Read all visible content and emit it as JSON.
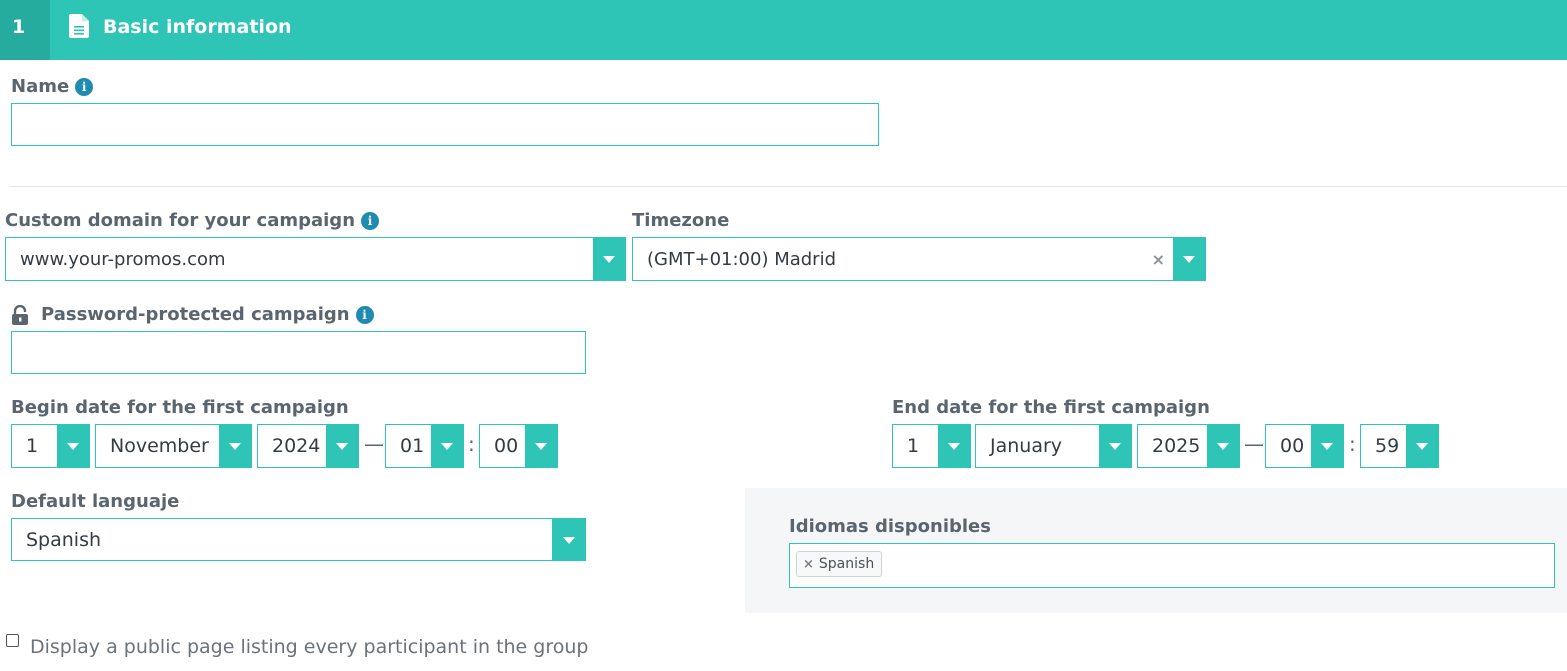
{
  "header": {
    "step_number": "1",
    "title": "Basic information",
    "icon": "file-text-icon",
    "color": "#2ec4b6"
  },
  "name_field": {
    "label": "Name",
    "value": "",
    "placeholder": ""
  },
  "domain": {
    "label": "Custom domain for your campaign",
    "value": "www.your-promos.com"
  },
  "timezone": {
    "label": "Timezone",
    "value": "(GMT+01:00) Madrid",
    "clear": "×"
  },
  "password": {
    "label": "Password-protected campaign",
    "value": ""
  },
  "begin_date": {
    "label": "Begin date for the first campaign",
    "day": "1",
    "month": "November",
    "year": "2024",
    "hour": "01",
    "minute": "00"
  },
  "end_date": {
    "label": "End date for the first campaign",
    "day": "1",
    "month": "January",
    "year": "2025",
    "hour": "00",
    "minute": "59"
  },
  "separators": {
    "dash": "—",
    "colon": ":"
  },
  "default_language": {
    "label": "Default languaje",
    "value": "Spanish"
  },
  "available_languages": {
    "label": "Idiomas disponibles",
    "tags": [
      {
        "label": "Spanish",
        "remove": "×"
      }
    ]
  },
  "public_page": {
    "label": "Display a public page listing every participant in the group",
    "checked": false
  }
}
